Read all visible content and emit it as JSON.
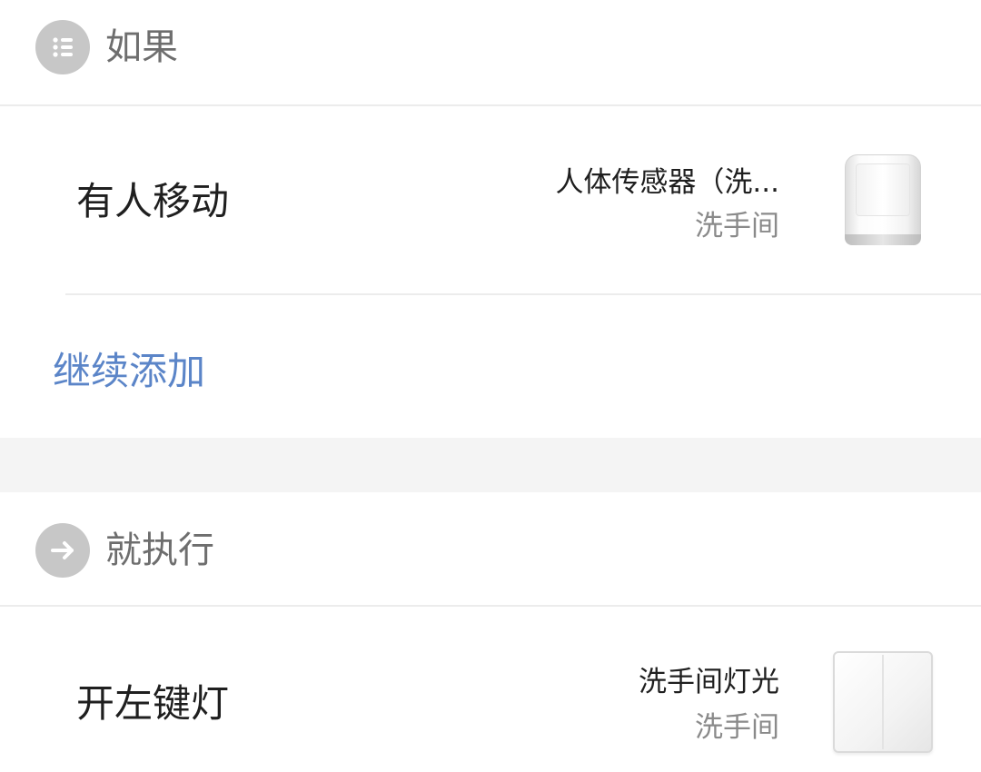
{
  "if_section": {
    "title": "如果",
    "icon": "list-icon"
  },
  "condition": {
    "title": "有人移动",
    "device_name": "人体传感器（洗...",
    "device_room": "洗手间",
    "device_image": "motion-sensor-image"
  },
  "add_more_label": "继续添加",
  "then_section": {
    "title": "就执行",
    "icon": "arrow-right-icon"
  },
  "action": {
    "title": "开左键灯",
    "device_name": "洗手间灯光",
    "device_room": "洗手间",
    "device_image": "wall-switch-image"
  },
  "colors": {
    "link": "#5b85c8",
    "icon_circle": "#c7c7c7",
    "section_gap": "#f4f4f4",
    "divider": "#ececec"
  }
}
